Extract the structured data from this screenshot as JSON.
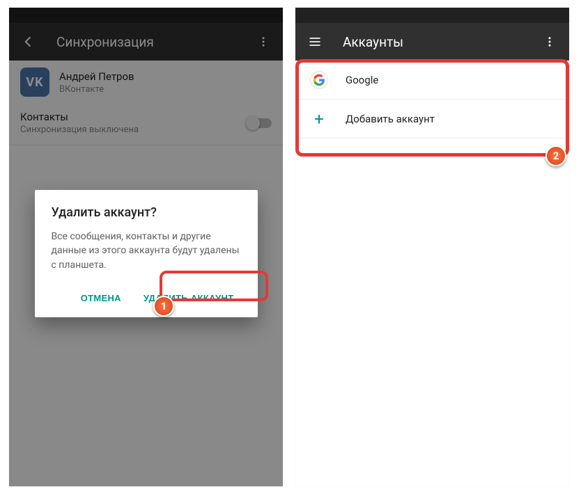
{
  "left": {
    "appbar_title": "Синхронизация",
    "account": {
      "name": "Андрей Петров",
      "service": "ВКонтакте",
      "vk_glyph": "VK"
    },
    "contacts": {
      "title": "Контакты",
      "subtitle": "Синхронизация выключена"
    },
    "dialog": {
      "title": "Удалить аккаунт?",
      "body": "Все сообщения, контакты и другие данные из этого аккаунта будут удалены с планшета.",
      "cancel": "ОТМЕНА",
      "confirm": "УДАЛИТЬ АККАУНТ"
    },
    "badge": "1"
  },
  "right": {
    "appbar_title": "Аккаунты",
    "items": [
      {
        "label": "Google"
      },
      {
        "label": "Добавить аккаунт"
      }
    ],
    "badge": "2"
  }
}
